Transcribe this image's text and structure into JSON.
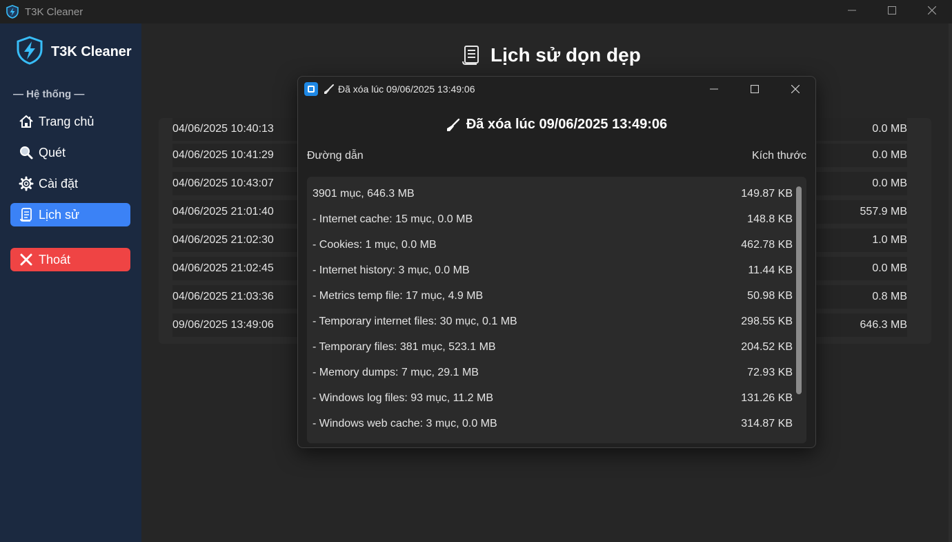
{
  "window": {
    "title": "T3K Cleaner"
  },
  "sidebar": {
    "brand": "T3K Cleaner",
    "section_label": "— Hệ thống —",
    "items": [
      {
        "label": "Trang chủ",
        "icon": "home-icon"
      },
      {
        "label": "Quét",
        "icon": "search-icon"
      },
      {
        "label": "Cài đặt",
        "icon": "gear-icon"
      },
      {
        "label": "Lịch sử",
        "icon": "scroll-icon",
        "active": true
      }
    ],
    "exit_label": "Thoát"
  },
  "main": {
    "title": "Lịch sử dọn dẹp",
    "history": [
      {
        "date": "04/06/2025 10:40:13",
        "size": "0.0 MB"
      },
      {
        "date": "04/06/2025 10:41:29",
        "size": "0.0 MB"
      },
      {
        "date": "04/06/2025 10:43:07",
        "size": "0.0 MB"
      },
      {
        "date": "04/06/2025 21:01:40",
        "size": "557.9 MB"
      },
      {
        "date": "04/06/2025 21:02:30",
        "size": "1.0 MB"
      },
      {
        "date": "04/06/2025 21:02:45",
        "size": "0.0 MB"
      },
      {
        "date": "04/06/2025 21:03:36",
        "size": "0.8 MB"
      },
      {
        "date": "09/06/2025 13:49:06",
        "size": "646.3 MB"
      }
    ]
  },
  "dialog": {
    "window_title": "Đã xóa lúc 09/06/2025 13:49:06",
    "heading": "Đã xóa lúc 09/06/2025 13:49:06",
    "col_path": "Đường dẫn",
    "col_size": "Kích thước",
    "rows": [
      {
        "path": "3901 mục, 646.3 MB",
        "size": "149.87 KB"
      },
      {
        "path": "- Internet cache: 15 mục, 0.0 MB",
        "size": "148.8 KB"
      },
      {
        "path": "- Cookies: 1 mục, 0.0 MB",
        "size": "462.78 KB"
      },
      {
        "path": "- Internet history: 3 mục, 0.0 MB",
        "size": "11.44 KB"
      },
      {
        "path": "- Metrics temp file: 17 mục, 4.9 MB",
        "size": "50.98 KB"
      },
      {
        "path": "- Temporary internet files: 30 mục, 0.1 MB",
        "size": "298.55 KB"
      },
      {
        "path": "- Temporary files: 381 mục, 523.1 MB",
        "size": "204.52 KB"
      },
      {
        "path": "- Memory dumps: 7 mục, 29.1 MB",
        "size": "72.93 KB"
      },
      {
        "path": "- Windows log files: 93 mục, 11.2 MB",
        "size": "131.26 KB"
      },
      {
        "path": "- Windows web cache: 3 mục, 0.0 MB",
        "size": "314.87 KB"
      }
    ]
  },
  "colors": {
    "sidebar_bg": "#1b2940",
    "active_nav": "#3b82f6",
    "exit_button": "#ef4444",
    "content_bg": "#262626",
    "dialog_bg": "#202020",
    "brand_icon": "#38bdf8"
  }
}
